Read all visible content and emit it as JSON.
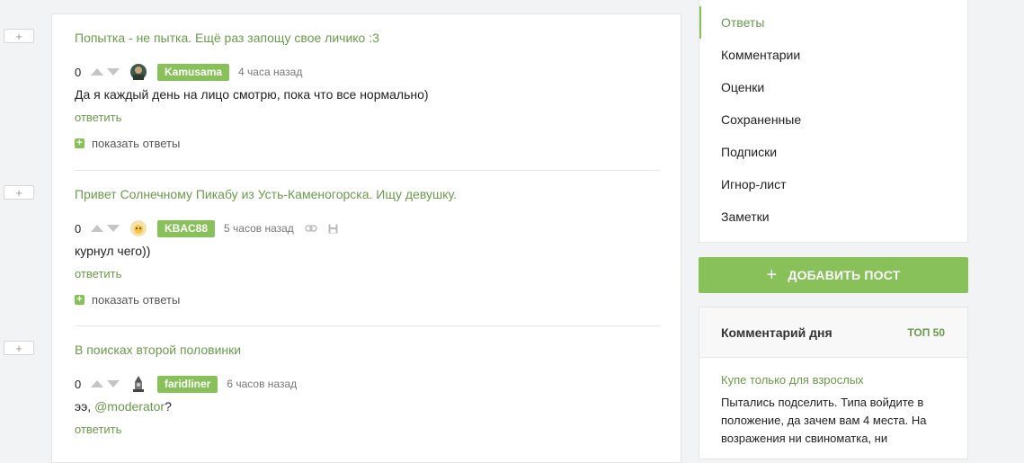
{
  "expand_label": "+",
  "comments": [
    {
      "post_title": "Попытка - не пытка.  Ещё раз запощу свое личико :3",
      "rating": "0",
      "user": "Kamusama",
      "time": "4 часа назад",
      "text": "Да я каждый день на лицо смотрю, пока что все нормально)",
      "reply": "ответить",
      "show_replies": "показать ответы"
    },
    {
      "post_title": "Привет Солнечному Пикабу из Усть-Каменогорска. Ищу девушку.",
      "rating": "0",
      "user": "KBAC88",
      "time": "5 часов назад",
      "text": "курнул чего))",
      "reply": "ответить",
      "show_replies": "показать ответы"
    },
    {
      "post_title": "В поисках второй половинки",
      "rating": "0",
      "user": "faridliner",
      "time": "6 часов назад",
      "text_prefix": "ээ, ",
      "mention": "@moderator",
      "text_suffix": "?",
      "reply": "ответить"
    }
  ],
  "sidebar": {
    "items": [
      {
        "label": "Ответы",
        "active": true
      },
      {
        "label": "Комментарии"
      },
      {
        "label": "Оценки"
      },
      {
        "label": "Сохраненные"
      },
      {
        "label": "Подписки"
      },
      {
        "label": "Игнор-лист"
      },
      {
        "label": "Заметки"
      }
    ]
  },
  "add_post": {
    "icon": "+",
    "label": "ДОБАВИТЬ ПОСТ"
  },
  "comment_of_day": {
    "title": "Комментарий дня",
    "top_link": "ТОП 50",
    "post_title": "Купе только для взрослых",
    "text": "Пытались подселить. Типа войдите в положение, да зачем вам 4 места. На возражения ни свиноматка, ни"
  },
  "colors": {
    "accent": "#88c15a",
    "link": "#6a9a4b"
  }
}
